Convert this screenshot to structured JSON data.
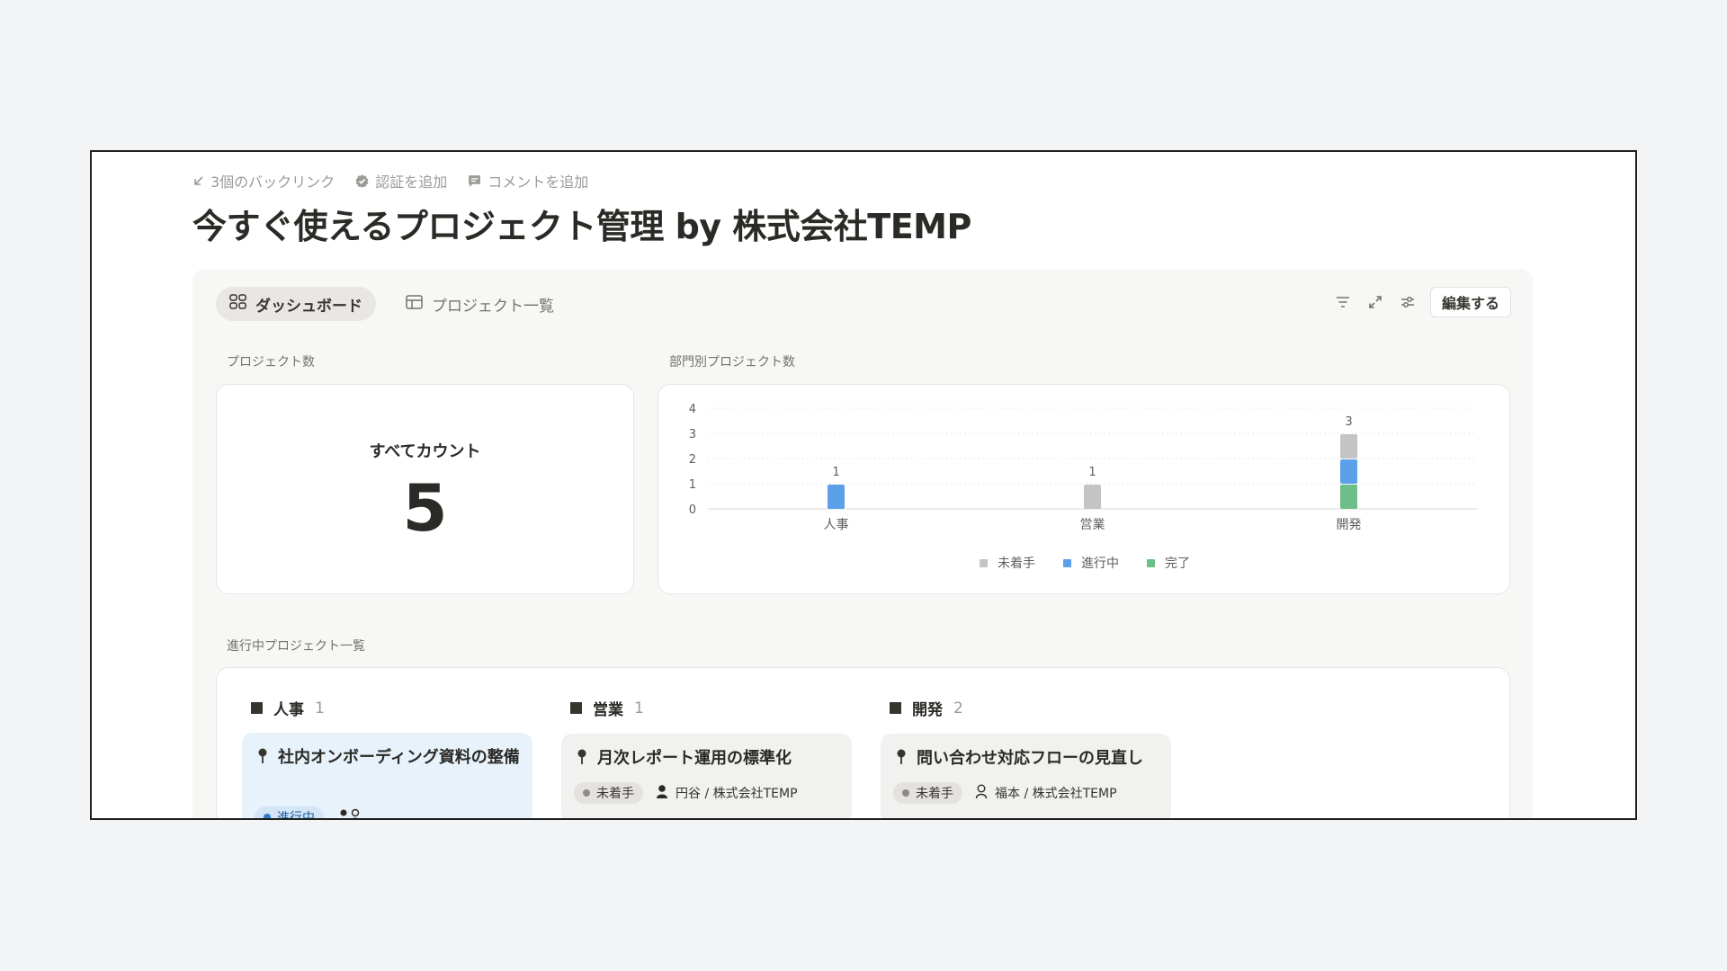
{
  "topbar": {
    "backlinks": "3個のバックリンク",
    "verify": "認証を追加",
    "comment": "コメントを追加"
  },
  "page": {
    "title": "今すぐ使えるプロジェクト管理 by 株式会社TEMP"
  },
  "tabs": [
    {
      "label": "ダッシュボード",
      "active": true
    },
    {
      "label": "プロジェクト一覧",
      "active": false
    }
  ],
  "toolbar": {
    "edit_label": "編集する"
  },
  "widgets": {
    "count_section": "プロジェクト数",
    "count_label": "すべてカウント",
    "count_value": "5",
    "chart_section": "部門別プロジェクト数",
    "board_section": "進行中プロジェクト一覧"
  },
  "chart_data": {
    "type": "bar",
    "stacked": true,
    "categories": [
      "人事",
      "営業",
      "開発"
    ],
    "series": [
      {
        "name": "完了",
        "values": [
          0,
          0,
          1
        ],
        "color": "#6dbf8a"
      },
      {
        "name": "進行中",
        "values": [
          1,
          0,
          1
        ],
        "color": "#5ba0e8"
      },
      {
        "name": "未着手",
        "values": [
          0,
          1,
          1
        ],
        "color": "#c4c4c4"
      }
    ],
    "totals": [
      1,
      1,
      3
    ],
    "ylim": [
      0,
      4
    ],
    "yticks": [
      0,
      1,
      2,
      3,
      4
    ],
    "legend_position": "bottom-center",
    "legend_order": [
      "未着手",
      "進行中",
      "完了"
    ],
    "grid": true
  },
  "board": {
    "columns": [
      {
        "name": "人事",
        "count": "1",
        "item": {
          "title": "社内オンボーディング資料の整備",
          "status": "進行中",
          "owner": ""
        }
      },
      {
        "name": "営業",
        "count": "1",
        "item": {
          "title": "月次レポート運用の標準化",
          "status": "未着手",
          "owner": "円谷 / 株式会社TEMP"
        }
      },
      {
        "name": "開発",
        "count": "2",
        "item": {
          "title": "問い合わせ対応フローの見直し",
          "status": "未着手",
          "owner": "福本 / 株式会社TEMP"
        }
      }
    ]
  },
  "icons": {
    "backlink": "arrow-down-left-icon",
    "verify": "verified-badge-icon",
    "comment": "comment-icon",
    "dashboard_tab": "dashboard-grid-icon",
    "list_tab": "table-icon",
    "filter": "filter-icon",
    "expand": "expand-icon",
    "settings": "sliders-icon",
    "pin": "pin-icon",
    "person": "person-icon"
  }
}
